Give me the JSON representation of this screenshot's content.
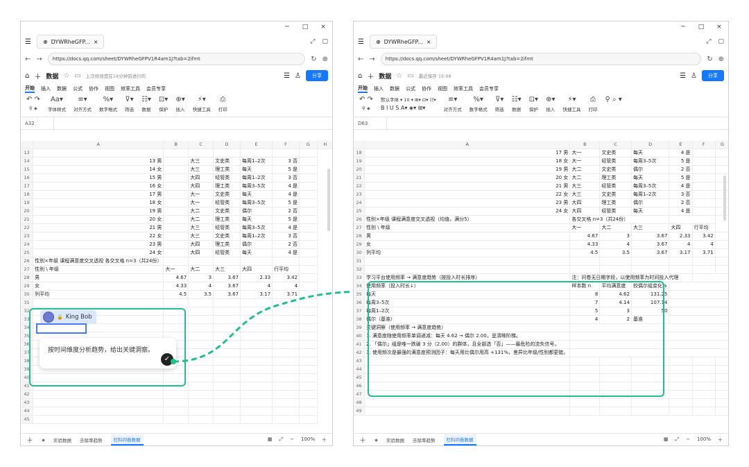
{
  "window": {
    "min": "─",
    "max": "□",
    "close": "×"
  },
  "browser": {
    "tab_title": "DYWRheGFP...",
    "url": "https://docs.qq.com/sheet/DYWRheGFPV1R4am1J?tab=2ifmt"
  },
  "doc": {
    "title": "数据",
    "share": "分享",
    "saved_left": "上次修改是在19分钟前进行的",
    "saved_right": "最近保存 15:09"
  },
  "menu": [
    "开始",
    "插入",
    "数据",
    "公式",
    "协作",
    "视图",
    "效率工具",
    "会员专享"
  ],
  "toolbar_left": [
    "字体样式",
    "对齐方式",
    "数字格式",
    "筛选",
    "数据",
    "保护",
    "插入",
    "快捷工具",
    "打印"
  ],
  "toolbar_right": [
    "对齐方式",
    "数字格式",
    "筛选",
    "数据",
    "保护",
    "插入",
    "快捷工具",
    "打印"
  ],
  "font_right": {
    "family": "默认字体",
    "size": "10"
  },
  "cellref": {
    "left": "A32",
    "right": "D63"
  },
  "cols_left": [
    "",
    "A",
    "B",
    "C",
    "D",
    "E",
    "F",
    "G",
    "H"
  ],
  "cols_right": [
    "",
    "A",
    "B",
    "C",
    "D",
    "E",
    "F",
    "G"
  ],
  "rows_left": [
    [
      "13",
      "",
      "",
      "",
      "",
      "",
      "",
      ""
    ],
    [
      "14",
      "13 男",
      "",
      "大三",
      "文史类",
      "每周1–2次",
      "3 否",
      ""
    ],
    [
      "15",
      "14 女",
      "",
      "大三",
      "理工类",
      "每天",
      "5 是",
      ""
    ],
    [
      "16",
      "15 男",
      "",
      "大四",
      "经管类",
      "每周1–2次",
      "3 否",
      ""
    ],
    [
      "17",
      "16 女",
      "",
      "大四",
      "理工类",
      "每周3–5次",
      "4 是",
      ""
    ],
    [
      "18",
      "17 男",
      "",
      "大一",
      "文史类",
      "每天",
      "4 是",
      ""
    ],
    [
      "19",
      "18 女",
      "",
      "大一",
      "经管类",
      "每周3–5次",
      "5 是",
      ""
    ],
    [
      "20",
      "19 男",
      "",
      "大二",
      "文史类",
      "偶尔",
      "2 否",
      ""
    ],
    [
      "21",
      "20 女",
      "",
      "大二",
      "理工类",
      "每天",
      "5 是",
      ""
    ],
    [
      "22",
      "21 男",
      "",
      "大三",
      "经管类",
      "每周3–5次",
      "4 是",
      ""
    ],
    [
      "23",
      "22 女",
      "",
      "大三",
      "文史类",
      "每周1–2次",
      "3 否",
      ""
    ],
    [
      "24",
      "23 男",
      "",
      "大四",
      "理工类",
      "偶尔",
      "2 否",
      ""
    ],
    [
      "25",
      "24 女",
      "",
      "大四",
      "经管类",
      "每天",
      "4 是",
      ""
    ],
    [
      "26",
      "性别×年级 课程满意度交叉透视 各交叉格 n=3（共24份）",
      "",
      "",
      "",
      "",
      "",
      ""
    ],
    [
      "27",
      "性别 \\ 年级",
      "大一",
      "大二",
      "大三",
      "大四",
      "行平均",
      ""
    ],
    [
      "28",
      "男",
      "4.67",
      "3",
      "3.67",
      "2.33",
      "3.42",
      ""
    ],
    [
      "29",
      "女",
      "4.33",
      "4",
      "3.67",
      "4",
      "4",
      ""
    ],
    [
      "30",
      "列平均",
      "4.5",
      "3.5",
      "3.67",
      "3.17",
      "3.71",
      ""
    ],
    [
      "31",
      "",
      "",
      "",
      "",
      "",
      "",
      ""
    ],
    [
      "32",
      "",
      "",
      "",
      "",
      "",
      "",
      ""
    ],
    [
      "33",
      "",
      "",
      "",
      "",
      "",
      "",
      ""
    ],
    [
      "34",
      "",
      "",
      "",
      "",
      "",
      "",
      ""
    ],
    [
      "35",
      "",
      "",
      "",
      "",
      "",
      "",
      ""
    ],
    [
      "36",
      "",
      "",
      "",
      "",
      "",
      "",
      ""
    ],
    [
      "37",
      "",
      "",
      "",
      "",
      "",
      "",
      ""
    ],
    [
      "38",
      "",
      "",
      "",
      "",
      "",
      "",
      ""
    ],
    [
      "39",
      "",
      "",
      "",
      "",
      "",
      "",
      ""
    ],
    [
      "40",
      "",
      "",
      "",
      "",
      "",
      "",
      ""
    ],
    [
      "41",
      "",
      "",
      "",
      "",
      "",
      "",
      ""
    ],
    [
      "42",
      "",
      "",
      "",
      "",
      "",
      "",
      ""
    ],
    [
      "43",
      "",
      "",
      "",
      "",
      "",
      "",
      ""
    ],
    [
      "44",
      "",
      "",
      "",
      "",
      "",
      "",
      ""
    ],
    [
      "45",
      "",
      "",
      "",
      "",
      "",
      "",
      ""
    ]
  ],
  "rows_right": [
    [
      "18",
      "17 男",
      "大一",
      "文史类",
      "每天",
      "4 是"
    ],
    [
      "19",
      "18 女",
      "大一",
      "经管类",
      "每周3–5次",
      "5 是"
    ],
    [
      "20",
      "19 男",
      "大二",
      "文史类",
      "偶尔",
      "2 否"
    ],
    [
      "21",
      "20 女",
      "大二",
      "理工类",
      "每天",
      "5 是"
    ],
    [
      "22",
      "21 男",
      "大三",
      "经管类",
      "每周3–5次",
      "4 是"
    ],
    [
      "23",
      "22 女",
      "大三",
      "文史类",
      "每周1–2次",
      "3 否"
    ],
    [
      "24",
      "23 男",
      "大四",
      "理工类",
      "偶尔",
      "2 否"
    ],
    [
      "25",
      "24 女",
      "大四",
      "经管类",
      "每天",
      "4 是"
    ]
  ],
  "right_pivot": {
    "r26": [
      "26",
      "性别×年级 课程满意度交叉透视（均值，满分5）",
      "各交叉格 n=3（共24份）"
    ],
    "r27": [
      "27",
      "性别 \\ 年级",
      "大一",
      "大二",
      "大三",
      "大四",
      "行平均"
    ],
    "r28": [
      "28",
      "男",
      "4.67",
      "3",
      "3.67",
      "2.33",
      "3.42"
    ],
    "r29": [
      "29",
      "女",
      "4.33",
      "4",
      "3.67",
      "4",
      "4"
    ],
    "r30": [
      "30",
      "列平均",
      "4.5",
      "3.5",
      "3.67",
      "3.17",
      "3.71"
    ]
  },
  "analysis": {
    "title": "学习平台使用频率 → 满意度趋势（按投入时长排序）",
    "note": "注：问卷无日期字段，以使用频率为时间投入代理",
    "headers": [
      "使用频率（投入时长↓）",
      "样本数 n",
      "平均满意度",
      "较偶尔组变化%"
    ],
    "rows": [
      [
        "每天",
        "8",
        "4.62",
        "131.25"
      ],
      [
        "每周3–5次",
        "7",
        "4.14",
        "107.14"
      ],
      [
        "每周1–2次",
        "5",
        "3",
        "50"
      ],
      [
        "偶尔（基准）",
        "4",
        "2",
        "基准"
      ]
    ],
    "insight_title": "关键洞察（使用频率 → 满意度趋势）",
    "insights": [
      "1. 满意度随使用频率单调递减：每天 4.62 → 偶尔 2.00，呈清晰阶梯。",
      "2. 「偶尔」组是唯一跌破 3 分（2.00）的群体，且全部选「否」——最危险的流失信号。",
      "3. 使用频次是最强的满意度预测因子：每天用比偶尔用高 +131%，差异比年级/性别都更陡。"
    ]
  },
  "row_numbers_right_tail": [
    "44",
    "45",
    "46",
    "47",
    "48",
    "49"
  ],
  "chat": {
    "user": "King Bob",
    "prompt": "按时间维度分析趋势，给出关键洞察。"
  },
  "sheets": [
    "实验数据",
    "去除率趋势",
    "社科问卷数据"
  ],
  "zoom": "100%"
}
